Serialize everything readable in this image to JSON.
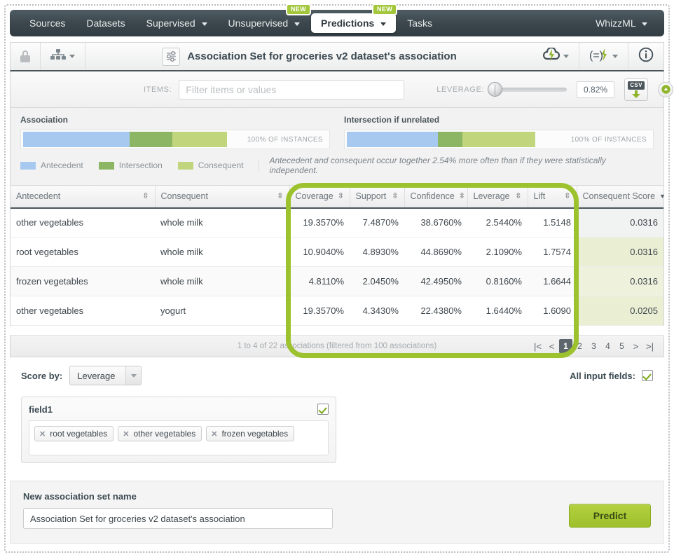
{
  "navbar": {
    "items": [
      {
        "label": "Sources",
        "caret": false,
        "badge": null,
        "active": false
      },
      {
        "label": "Datasets",
        "caret": false,
        "badge": null,
        "active": false
      },
      {
        "label": "Supervised",
        "caret": true,
        "badge": null,
        "active": false
      },
      {
        "label": "Unsupervised",
        "caret": true,
        "badge": "NEW",
        "active": false
      },
      {
        "label": "Predictions",
        "caret": true,
        "badge": "NEW",
        "active": true
      },
      {
        "label": "Tasks",
        "caret": false,
        "badge": null,
        "active": false
      }
    ],
    "right": {
      "label": "WhizzML",
      "caret": true
    }
  },
  "titlebar": {
    "lock_icon": "lock-icon",
    "tree_icon": "resource-tree-icon",
    "settings_icon": "association-settings-icon",
    "title": "Association Set for groceries v2 dataset's association",
    "tool_cloud": "cloud-action-icon",
    "tool_equals": "evaluate-icon",
    "tool_info": "info-icon"
  },
  "filterbar": {
    "items_label": "ITEMS:",
    "items_placeholder": "Filter items or values",
    "items_value": "",
    "leverage_label": "LEVERAGE:",
    "leverage_value": "0.82%",
    "leverage_slider_pct": 0,
    "csv_label": "CSV",
    "collapse_icon": "collapse-up-icon"
  },
  "summary": {
    "left": {
      "title": "Association",
      "note": "100% OF INSTANCES",
      "segments": [
        {
          "name": "Antecedent",
          "color": "#a8c9ef",
          "width_pct": 37
        },
        {
          "name": "Intersection",
          "color": "#8cb664",
          "width_pct": 22
        },
        {
          "name": "Consequent",
          "color": "#c1d67c",
          "width_pct": 53
        }
      ]
    },
    "right": {
      "title": "Intersection if unrelated",
      "note": "100% OF INSTANCES",
      "segments": [
        {
          "name": "Antecedent",
          "color": "#a8c9ef",
          "width_pct": 42
        },
        {
          "name": "Intersection",
          "color": "#8cb664",
          "width_pct": 14
        },
        {
          "name": "Consequent",
          "color": "#c1d67c",
          "width_pct": 60
        }
      ]
    },
    "legend": [
      {
        "label": "Antecedent",
        "color": "#a8c9ef"
      },
      {
        "label": "Intersection",
        "color": "#8cb664"
      },
      {
        "label": "Consequent",
        "color": "#c1d67c"
      }
    ],
    "legend_note": "Antecedent and consequent occur together 2.54% more often than if they were statistically independent."
  },
  "table": {
    "columns": [
      {
        "label": "Antecedent",
        "sort": "both"
      },
      {
        "label": "Consequent",
        "sort": "both"
      },
      {
        "label": "Coverage",
        "sort": "both"
      },
      {
        "label": "Support",
        "sort": "both"
      },
      {
        "label": "Confidence",
        "sort": "both"
      },
      {
        "label": "Leverage",
        "sort": "both"
      },
      {
        "label": "Lift",
        "sort": "both"
      },
      {
        "label": "Consequent Score",
        "sort": "desc"
      }
    ],
    "rows": [
      {
        "antecedent": "other vegetables",
        "consequent": "whole milk",
        "coverage": "19.3570%",
        "support": "7.4870%",
        "confidence": "38.6760%",
        "leverage": "2.5440%",
        "lift": "1.5148",
        "score": "0.0316"
      },
      {
        "antecedent": "root vegetables",
        "consequent": "whole milk",
        "coverage": "10.9040%",
        "support": "4.8930%",
        "confidence": "44.8690%",
        "leverage": "2.1090%",
        "lift": "1.7574",
        "score": "0.0316"
      },
      {
        "antecedent": "frozen vegetables",
        "consequent": "whole milk",
        "coverage": "4.8110%",
        "support": "2.0450%",
        "confidence": "42.4950%",
        "leverage": "0.8160%",
        "lift": "1.6644",
        "score": "0.0316"
      },
      {
        "antecedent": "other vegetables",
        "consequent": "yogurt",
        "coverage": "19.3570%",
        "support": "4.3430%",
        "confidence": "22.4380%",
        "leverage": "1.6440%",
        "lift": "1.6090",
        "score": "0.0205"
      }
    ],
    "footer_text": "1 to 4 of 22 associations (filtered from 100 associations)",
    "pager": [
      "|<",
      "<",
      "1",
      "2",
      "3",
      "4",
      "5",
      ">",
      ">|"
    ],
    "pager_current": "1"
  },
  "lower": {
    "score_by_label": "Score by:",
    "score_by_value": "Leverage",
    "all_input_fields_label": "All input fields:",
    "all_input_fields_checked": true,
    "field": {
      "name": "field1",
      "checked": true,
      "tokens": [
        "root vegetables",
        "other vegetables",
        "frozen vegetables"
      ]
    }
  },
  "bottom": {
    "name_label": "New association set name",
    "name_value": "Association Set for groceries v2 dataset's association",
    "predict_label": "Predict"
  },
  "colors": {
    "brand_green": "#9cc22e",
    "nav_dark": "#3c474d",
    "antecedent": "#a8c9ef",
    "intersection": "#8cb664",
    "consequent": "#c1d67c",
    "annotation": "#9cc22e"
  }
}
